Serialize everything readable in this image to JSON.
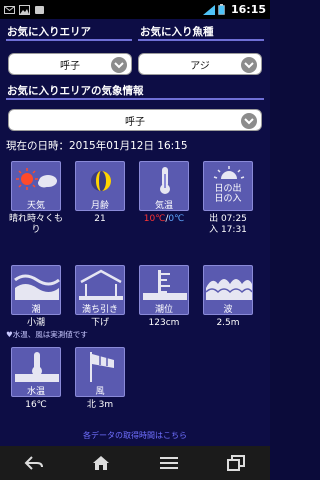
{
  "status": {
    "time": "16:15",
    "network": "4G"
  },
  "favorites": {
    "area_title": "お気に入りエリア",
    "fish_title": "お気に入り魚種",
    "area_value": "呼子",
    "fish_value": "アジ",
    "weather_title": "お気に入りエリアの気象情報",
    "weather_area_value": "呼子"
  },
  "datetime": "現在の日時：2015年01月12日 16:15",
  "tiles": [
    {
      "label": "天気",
      "value": "晴れ時々くもり",
      "icon": "sun-cloud-icon"
    },
    {
      "label": "月齢",
      "value": "21",
      "icon": "moon-icon"
    },
    {
      "label": "気温",
      "value_hot": "10℃",
      "value_sep": "/",
      "value_cold": "0℃",
      "icon": "thermometer-icon"
    },
    {
      "label": "日の出\n日の入",
      "value": "出 07:25\n入 17:31",
      "icon": "sunrise-icon"
    },
    {
      "label": "潮",
      "value": "小潮",
      "icon": "tide-wave-icon"
    },
    {
      "label": "満ち引き",
      "value": "下げ",
      "icon": "ebb-flow-icon"
    },
    {
      "label": "潮位",
      "value": "123cm",
      "icon": "tide-level-icon"
    },
    {
      "label": "波",
      "value": "2.5m",
      "icon": "waves-icon"
    },
    {
      "label": "水温",
      "value": "16℃",
      "icon": "water-temp-icon"
    },
    {
      "label": "風",
      "value": "北 3m",
      "icon": "windsock-icon"
    }
  ],
  "note": "♥水温、風は実測値です",
  "footer_link": "各データの取得時間はこちら",
  "colors": {
    "accent": "#6f6fd6",
    "tile": "#5a5ab0",
    "background": "#0d0d45",
    "hot": "#ff3333",
    "cold": "#5fa8ff",
    "link": "#7070ff"
  }
}
